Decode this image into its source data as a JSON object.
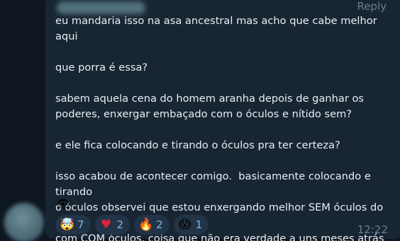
{
  "header": {
    "reply_label": "Reply"
  },
  "message": {
    "paragraphs": [
      "eu mandaria isso na asa ancestral mas acho que cabe melhor aqui",
      "que porra é essa?",
      "sabem aquela cena do homem aranha depois de ganhar os\npoderes, enxergar embaçado com o óculos e nítido sem?",
      "e ele fica colocando e tirando o óculos pra ter certeza?",
      "isso acabou de acontecer comigo.  basicamente colocando e tirando\no óculos observei que estou enxergando melhor SEM óculos do que\ncom COM óculos, coisa que não era verdade a uns meses atrás"
    ],
    "inline_emoji": "👁",
    "time": "12:22"
  },
  "reactions": [
    {
      "emoji": "🤯",
      "icon": "mind-blown-icon",
      "count": "7"
    },
    {
      "emoji": "♥",
      "icon": "heart-icon",
      "count": "2"
    },
    {
      "emoji": "🔥",
      "icon": "fire-icon",
      "count": "2"
    },
    {
      "emoji": "😱",
      "icon": "scream-icon",
      "count": "1"
    }
  ],
  "colors": {
    "background": "#0e1621",
    "bubble": "#182533",
    "text": "#e9eef2",
    "meta": "#6d7f8f",
    "reaction_bg": "#233447",
    "reaction_count": "#74b9f0"
  }
}
